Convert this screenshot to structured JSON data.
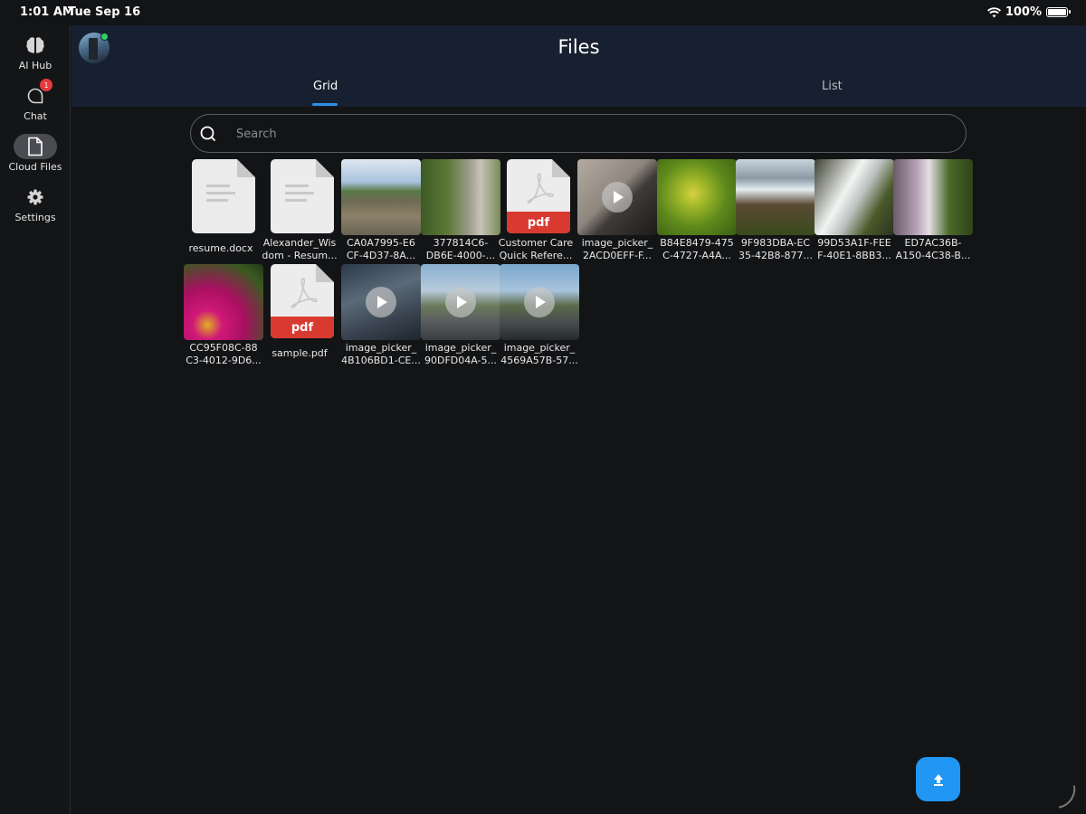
{
  "status_bar": {
    "time": "1:01 AM",
    "date": "Tue Sep 16",
    "battery": "100%",
    "battery_level": 1.0
  },
  "sidebar": {
    "items": [
      {
        "label": "AI Hub",
        "icon": "brain-icon",
        "active": false
      },
      {
        "label": "Chat",
        "icon": "chat-bubble-icon",
        "badge": "1",
        "active": false
      },
      {
        "label": "Cloud Files",
        "icon": "document-icon",
        "active": true
      },
      {
        "label": "Settings",
        "icon": "gear-icon",
        "active": false
      }
    ]
  },
  "header": {
    "title": "Files",
    "tabs": [
      {
        "label": "Grid",
        "selected": true
      },
      {
        "label": "List",
        "selected": false
      }
    ]
  },
  "search": {
    "placeholder": "Search",
    "value": ""
  },
  "files": [
    {
      "name_line1": "resume.docx",
      "name_line2": "",
      "type": "document"
    },
    {
      "name_line1": "Alexander_Wis",
      "name_line2": "dom - Resum...",
      "type": "document"
    },
    {
      "name_line1": "CA0A7995-E6",
      "name_line2": "CF-4D37-8A...",
      "type": "image"
    },
    {
      "name_line1": "377814C6-",
      "name_line2": "DB6E-4000-...",
      "type": "image"
    },
    {
      "name_line1": "Customer Care",
      "name_line2": "Quick Refere...",
      "type": "pdf"
    },
    {
      "name_line1": "image_picker_",
      "name_line2": "2ACD0EFF-F...",
      "type": "video"
    },
    {
      "name_line1": "B84E8479-475",
      "name_line2": "C-4727-A4A...",
      "type": "image"
    },
    {
      "name_line1": "9F983DBA-EC",
      "name_line2": "35-42B8-877...",
      "type": "image"
    },
    {
      "name_line1": "99D53A1F-FEE",
      "name_line2": "F-40E1-8BB3...",
      "type": "image"
    },
    {
      "name_line1": "ED7AC36B-",
      "name_line2": "A150-4C38-B...",
      "type": "image"
    },
    {
      "name_line1": "CC95F08C-88",
      "name_line2": "C3-4012-9D6...",
      "type": "image"
    },
    {
      "name_line1": "sample.pdf",
      "name_line2": "",
      "type": "pdf"
    },
    {
      "name_line1": "image_picker_",
      "name_line2": "4B106BD1-CE...",
      "type": "video"
    },
    {
      "name_line1": "image_picker_",
      "name_line2": "90DFD04A-5...",
      "type": "video"
    },
    {
      "name_line1": "image_picker_",
      "name_line2": "4569A57B-57...",
      "type": "video"
    }
  ],
  "pdf_badge": "pdf",
  "upload_button": {
    "icon": "upload-icon"
  },
  "colors": {
    "accent": "#2196f3",
    "header_bg": "#172030",
    "background": "#131416",
    "pdf_red": "#d93a30",
    "online": "#2fd35a",
    "badge": "#e5393b"
  }
}
